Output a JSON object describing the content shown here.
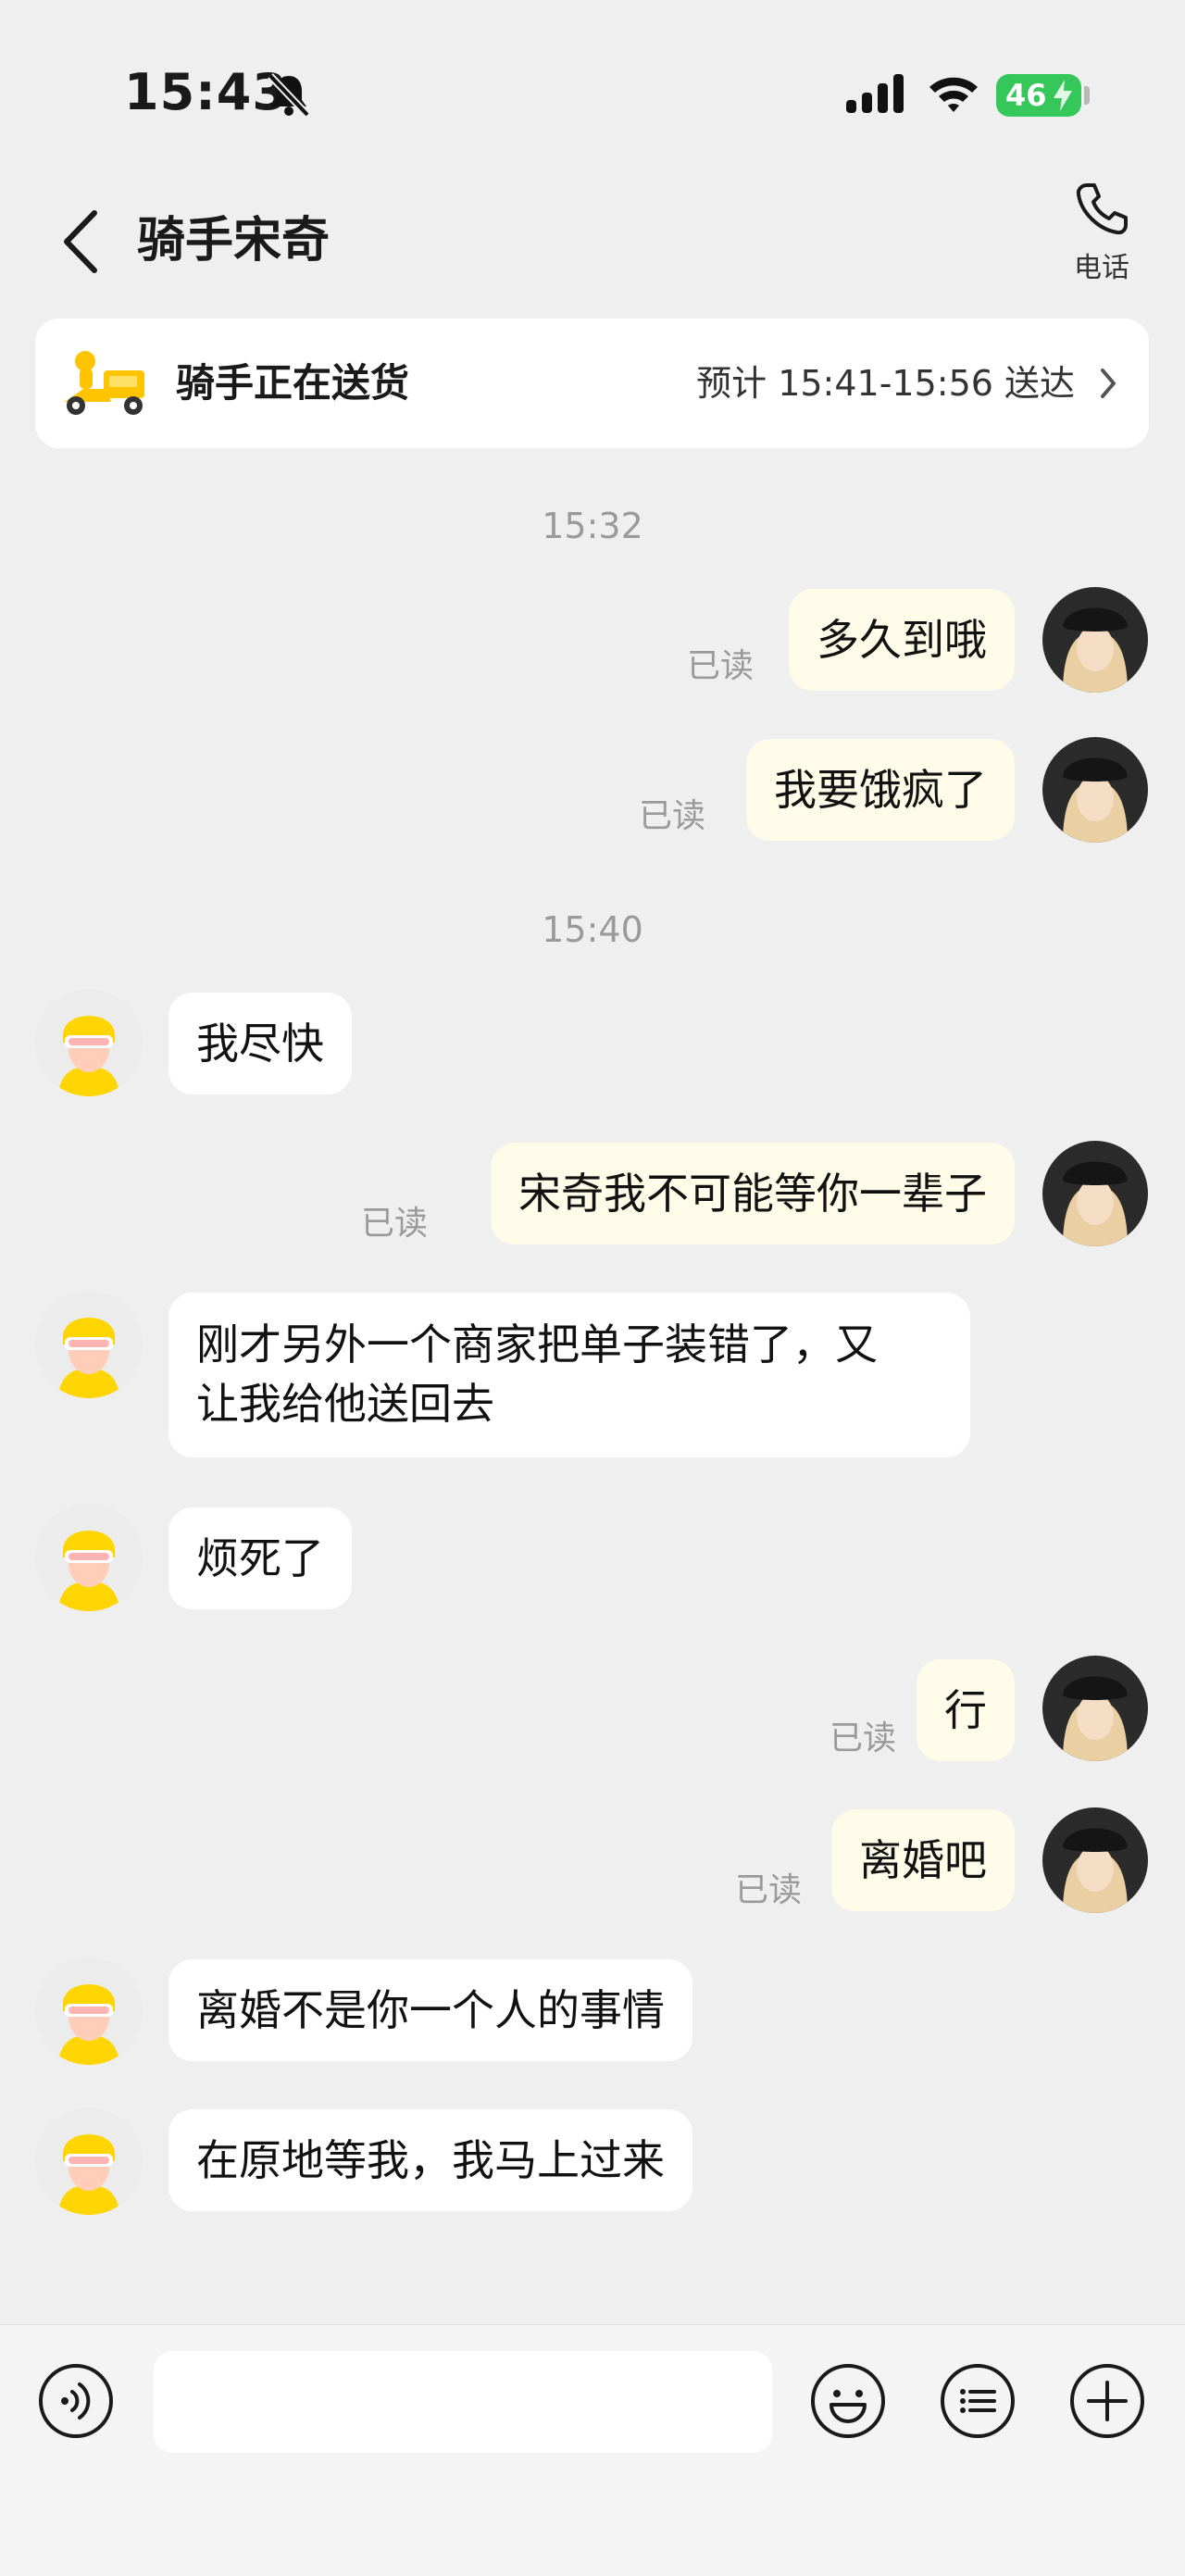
{
  "status_bar": {
    "time": "15:43",
    "battery": "46"
  },
  "nav": {
    "title": "骑手宋奇",
    "call_label": "电话"
  },
  "delivery": {
    "status": "骑手正在送货",
    "eta": "预计 15:41-15:56 送达"
  },
  "timestamps": [
    "15:32",
    "15:40"
  ],
  "read_label": "已读",
  "messages": [
    {
      "from": "me",
      "text": "多久到哦",
      "read": "已读"
    },
    {
      "from": "me",
      "text": "我要饿疯了",
      "read": "已读"
    },
    {
      "from": "rider",
      "text": "我尽快"
    },
    {
      "from": "me",
      "text": "宋奇我不可能等你一辈子",
      "read": "已读"
    },
    {
      "from": "rider",
      "lines": [
        "刚才另外一个商家把单子装错了，又",
        "让我给他送回去"
      ]
    },
    {
      "from": "rider",
      "text": "烦死了"
    },
    {
      "from": "me",
      "text": "行",
      "read": "已读"
    },
    {
      "from": "me",
      "text": "离婚吧",
      "read": "已读"
    },
    {
      "from": "rider",
      "text": "离婚不是你一个人的事情"
    },
    {
      "from": "rider",
      "text": "在原地等我，我马上过来"
    }
  ],
  "input": {
    "placeholder": ""
  },
  "icons": [
    "voice-icon",
    "emoji-icon",
    "quick-reply-icon",
    "plus-icon",
    "phone-icon",
    "back-icon",
    "bell-muted-icon"
  ],
  "colors": {
    "background": "#efefef",
    "my_bubble": "#fffbe9",
    "rider_bubble": "#ffffff",
    "battery": "#35c759",
    "rider_yellow": "#ffd500"
  }
}
